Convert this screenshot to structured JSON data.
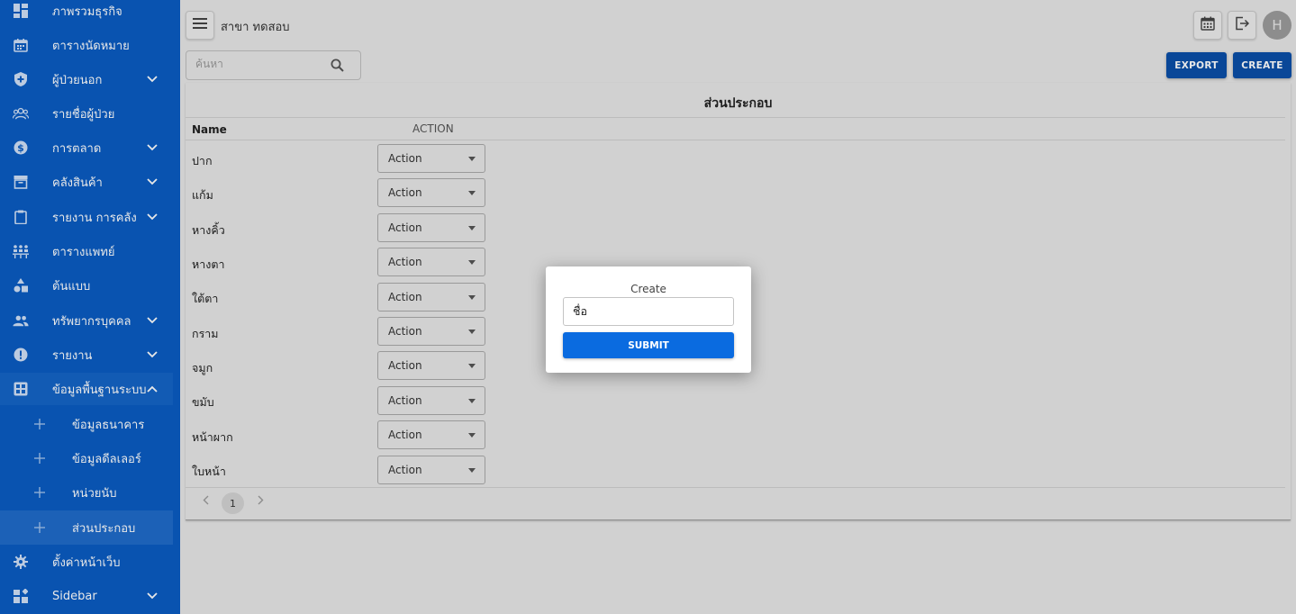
{
  "sidebar": {
    "items": [
      {
        "label": "ภาพรวมธุรกิจ",
        "icon": "dashboard-icon"
      },
      {
        "label": "ตารางนัดหมาย",
        "icon": "calendar-icon"
      },
      {
        "label": "ผู้ป่วยนอก",
        "icon": "shield-icon"
      },
      {
        "label": "รายชื่อผู้ป่วย",
        "icon": "group-icon"
      },
      {
        "label": "การตลาด",
        "icon": "dollar-icon"
      },
      {
        "label": "คลังสินค้า",
        "icon": "archive-icon"
      },
      {
        "label": "รายงาน การคลัง",
        "icon": "clipboard-icon"
      },
      {
        "label": "ตารางแพทย์",
        "icon": "doctor-schedule-icon"
      },
      {
        "label": "ต้นแบบ",
        "icon": "shapes-icon"
      },
      {
        "label": "ทรัพยากรบุคคล",
        "icon": "people-icon"
      },
      {
        "label": "รายงาน",
        "icon": "alert-icon"
      },
      {
        "label": "ข้อมูลพื้นฐานระบบ",
        "icon": "grid-icon"
      },
      {
        "label": "ข้อมูลธนาคาร",
        "icon": "plus-icon"
      },
      {
        "label": "ข้อมูลดีลเลอร์",
        "icon": "plus-icon"
      },
      {
        "label": "หน่วยนับ",
        "icon": "plus-icon"
      },
      {
        "label": "ส่วนประกอบ",
        "icon": "plus-icon"
      },
      {
        "label": "ตั้งค่าหน้าเว็บ",
        "icon": "gear-icon"
      },
      {
        "label": "Sidebar",
        "icon": "widgets-icon"
      }
    ]
  },
  "topbar": {
    "branch": "สาขา ทดสอบ",
    "avatar_letter": "H"
  },
  "search": {
    "placeholder": "ค้นหา"
  },
  "actions": {
    "export_label": "EXPORT",
    "create_label": "CREATE"
  },
  "table": {
    "title": "ส่วนประกอบ",
    "col_name": "Name",
    "col_action": "ACTION",
    "action_label": "Action",
    "rows": [
      "ปาก",
      "แก้ม",
      "หางคิ้ว",
      "หางตา",
      "ใต้ตา",
      "กราม",
      "จมูก",
      "ขมับ",
      "หน้าผาก",
      "ใบหน้า"
    ]
  },
  "pagination": {
    "current_page": "1"
  },
  "modal": {
    "title": "Create",
    "input_value": "ชื่อ",
    "submit_label": "SUBMIT"
  },
  "colors": {
    "sidebar_bg": "#0a5cc2",
    "primary_button": "#0a4fa8",
    "submit_button": "#0a6be0"
  }
}
